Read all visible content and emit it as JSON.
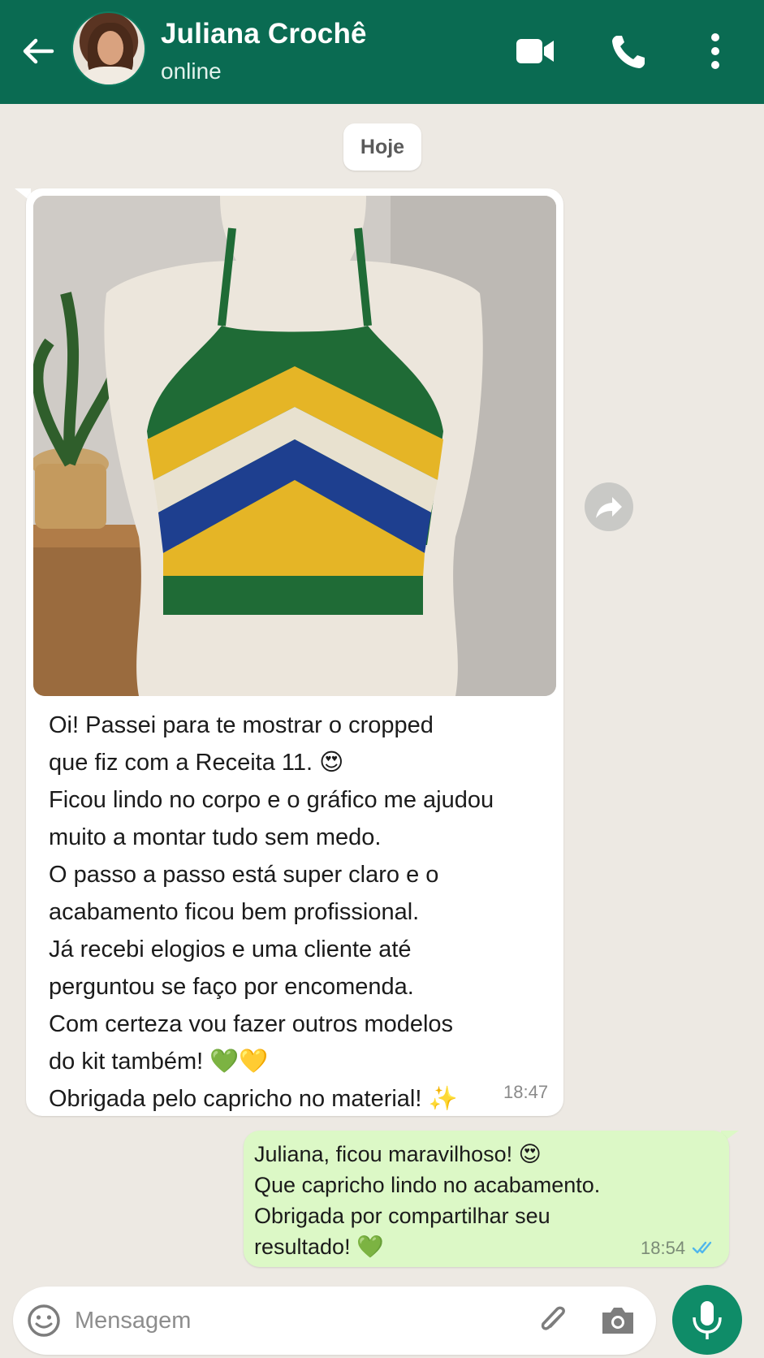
{
  "header": {
    "contact_name": "Juliana Crochê",
    "status": "online",
    "icons": [
      "back-arrow-icon",
      "video-call-icon",
      "phone-icon",
      "more-options-icon"
    ]
  },
  "chat": {
    "date_chip": "Hoje",
    "incoming": {
      "image_alt": "cropped de crochê em ziguezague verde, amarelo, creme e azul no manequim",
      "lines": [
        "Oi! Passei para te mostrar o cropped",
        "que fiz com a Receita 11. 😍",
        "Ficou lindo no corpo e o gráfico me ajudou",
        "muito a montar tudo sem medo.",
        "O passo a passo está super claro e o",
        "acabamento ficou bem profissional.",
        "Já recebi elogios e uma cliente até",
        "perguntou se faço por encomenda.",
        "Com certeza vou fazer outros modelos",
        "do kit também! 💚💛",
        "Obrigada pelo capricho no material! ✨"
      ],
      "time": "18:47"
    },
    "outgoing": {
      "lines": [
        "Juliana, ficou maravilhoso! 😍",
        "Que capricho lindo no acabamento.",
        "Obrigada por compartilhar seu",
        "resultado! 💚"
      ],
      "time": "18:54",
      "status": "read"
    }
  },
  "composer": {
    "placeholder": "Mensagem",
    "icons": [
      "emoji-icon",
      "attach-icon",
      "camera-icon",
      "mic-icon"
    ]
  },
  "colors": {
    "header": "#0a6b52",
    "outgoing_bubble": "#dcf8c6",
    "incoming_bubble": "#ffffff",
    "background": "#ede9e3",
    "mic_button": "#0f8c68",
    "read_ticks": "#4fb6ec"
  }
}
